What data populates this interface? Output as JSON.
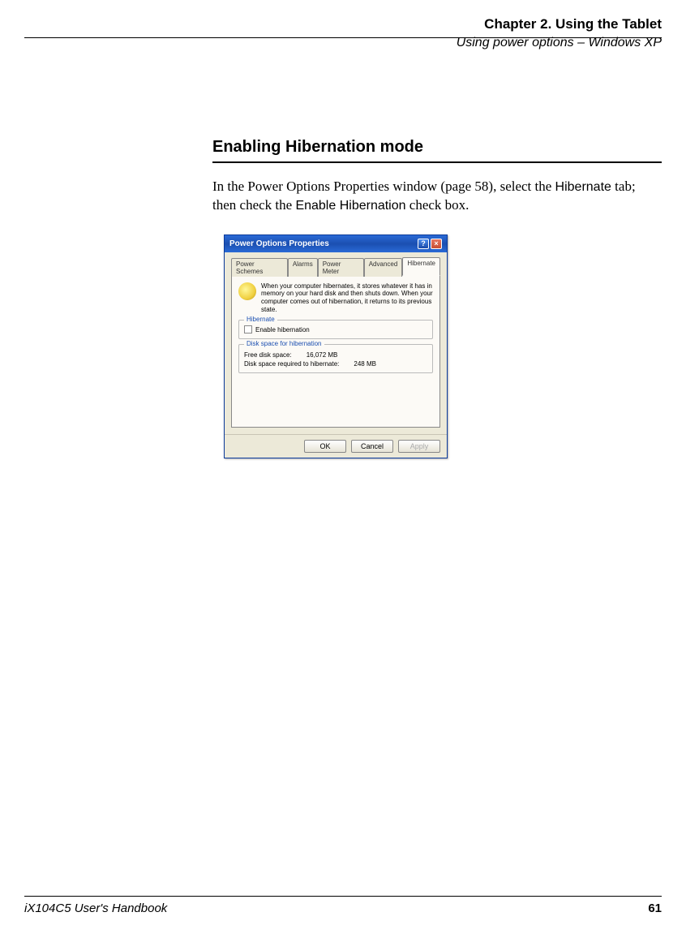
{
  "header": {
    "chapter": "Chapter 2. Using the Tablet",
    "section": "Using power options – Windows XP"
  },
  "content": {
    "heading": "Enabling Hibernation mode",
    "para_before_hibernate": "In the Power Options Properties window (page 58), select the ",
    "hibernate_term": "Hibernate",
    "para_mid": " tab; then check the ",
    "enable_term": "Enable Hibernation",
    "para_end": " check box."
  },
  "dialog": {
    "title": "Power Options Properties",
    "tabs": [
      "Power Schemes",
      "Alarms",
      "Power Meter",
      "Advanced",
      "Hibernate"
    ],
    "active_tab": "Hibernate",
    "info_text": "When your computer hibernates, it stores whatever it has in memory on your hard disk and then shuts down. When your computer comes out of hibernation, it returns to its previous state.",
    "group1_title": "Hibernate",
    "checkbox_label": "Enable hibernation",
    "group2_title": "Disk space for hibernation",
    "free_disk_label": "Free disk space:",
    "free_disk_value": "16,072 MB",
    "required_label": "Disk space required to hibernate:",
    "required_value": "248 MB",
    "buttons": {
      "ok": "OK",
      "cancel": "Cancel",
      "apply": "Apply"
    }
  },
  "footer": {
    "handbook": "iX104C5 User's Handbook",
    "page": "61"
  }
}
